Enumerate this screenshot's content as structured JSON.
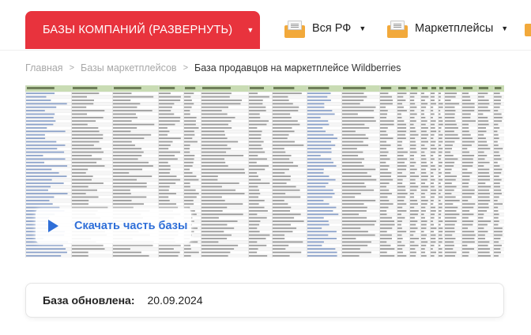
{
  "nav": {
    "main_label": "БАЗЫ КОМПАНИЙ (РАЗВЕРНУТЬ)",
    "region_label": "Вся РФ",
    "category_label": "Маркетплейсы",
    "accent_color": "#e8333d",
    "icon": "folder-box-icon"
  },
  "breadcrumb": {
    "home": "Главная",
    "section": "Базы маркетплейсов",
    "current": "База продавцов на маркетплейсе Wildberries"
  },
  "sheet": {
    "header_color": "#c9dcb4",
    "row_count": 48
  },
  "download": {
    "label": "Скачать часть базы",
    "color": "#2f6fd8"
  },
  "update": {
    "label": "База обновлена:",
    "date": "20.09.2024"
  }
}
